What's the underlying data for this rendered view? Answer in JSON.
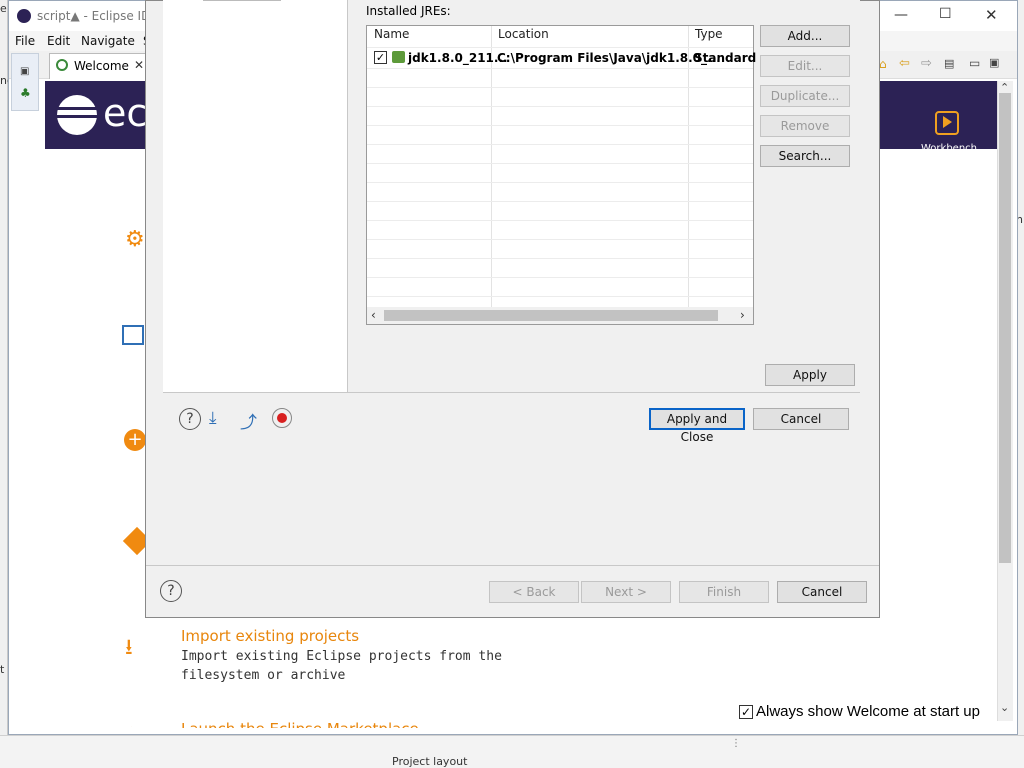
{
  "window": {
    "title": "script▲ - Eclipse IDE",
    "controls": [
      "—",
      "☐",
      "✕"
    ]
  },
  "menu": [
    "File",
    "Edit",
    "Navigate",
    "S"
  ],
  "welcome": {
    "tab_label": "Welcome",
    "banner_text": "ec",
    "workbench_label": "Workbench",
    "import_title": "Import existing projects",
    "import_desc_1": "Import existing Eclipse projects from the",
    "import_desc_2": "filesystem or archive",
    "partial_title": "Launch the Eclipse Marketplace",
    "always_show_label": "Always show Welcome at start up",
    "always_show_checked": true
  },
  "desktop": {
    "bottom_text": "Project layout",
    "left_text": "ng",
    "right_text": "n",
    "left_char_e": "e",
    "left_char_t": "t f"
  },
  "preferences": {
    "section_label": "Installed JREs:",
    "columns": [
      "Name",
      "Location",
      "Type"
    ],
    "rows": [
      {
        "checked": true,
        "name": "jdk1.8.0_211...",
        "location": "C:\\Program Files\\Java\\jdk1.8.0_...",
        "type": "Standard ..."
      }
    ],
    "side_buttons": [
      {
        "label": "Add...",
        "enabled": true
      },
      {
        "label": "Edit...",
        "enabled": false
      },
      {
        "label": "Duplicate...",
        "enabled": false
      },
      {
        "label": "Remove",
        "enabled": false
      },
      {
        "label": "Search...",
        "enabled": true
      }
    ],
    "apply_label": "Apply",
    "apply_close_label": "Apply and Close",
    "cancel_label": "Cancel"
  },
  "wizard": {
    "back_label": "< Back",
    "next_label": "Next >",
    "finish_label": "Finish",
    "cancel_label": "Cancel"
  },
  "colors": {
    "banner": "#2c2255",
    "accent_orange": "#e8860c",
    "primary_border": "#0a64c8"
  }
}
